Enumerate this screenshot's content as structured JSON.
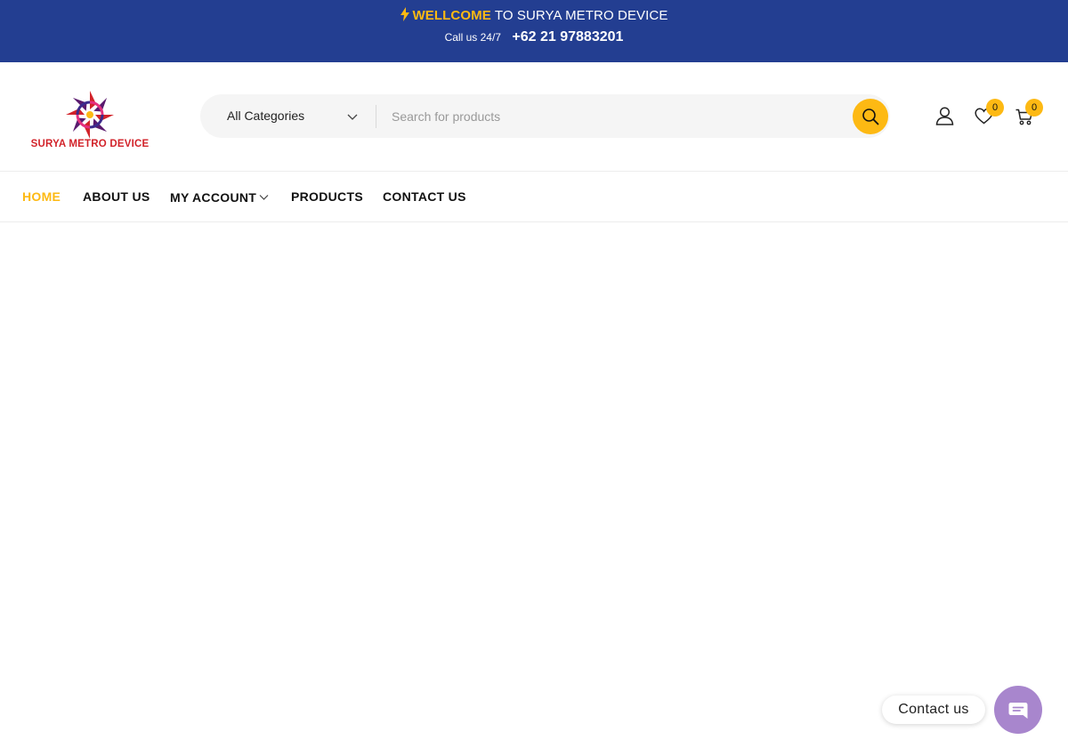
{
  "topbar": {
    "welcome_highlight": "WELLCOME",
    "welcome_rest": " TO SURYA METRO DEVICE",
    "call_label": "Call us 24/7",
    "phone": "+62 21 97883201"
  },
  "logo": {
    "text": "SURYA METRO DEVICE"
  },
  "search": {
    "category_selected": "All Categories",
    "placeholder": "Search for products",
    "value": ""
  },
  "header_icons": {
    "wishlist_count": "0",
    "cart_count": "0"
  },
  "nav": {
    "items": [
      {
        "label": "HOME",
        "active": true
      },
      {
        "label": "ABOUT US"
      },
      {
        "label": "MY ACCOUNT",
        "dropdown": true
      },
      {
        "label": "PRODUCTS"
      },
      {
        "label": "CONTACT US"
      }
    ]
  },
  "floating": {
    "contact_label": "Contact us"
  },
  "colors": {
    "topbar_bg": "#233e91",
    "accent": "#fdb913",
    "chat_button": "#a886cd",
    "logo_red": "#d2232a"
  }
}
